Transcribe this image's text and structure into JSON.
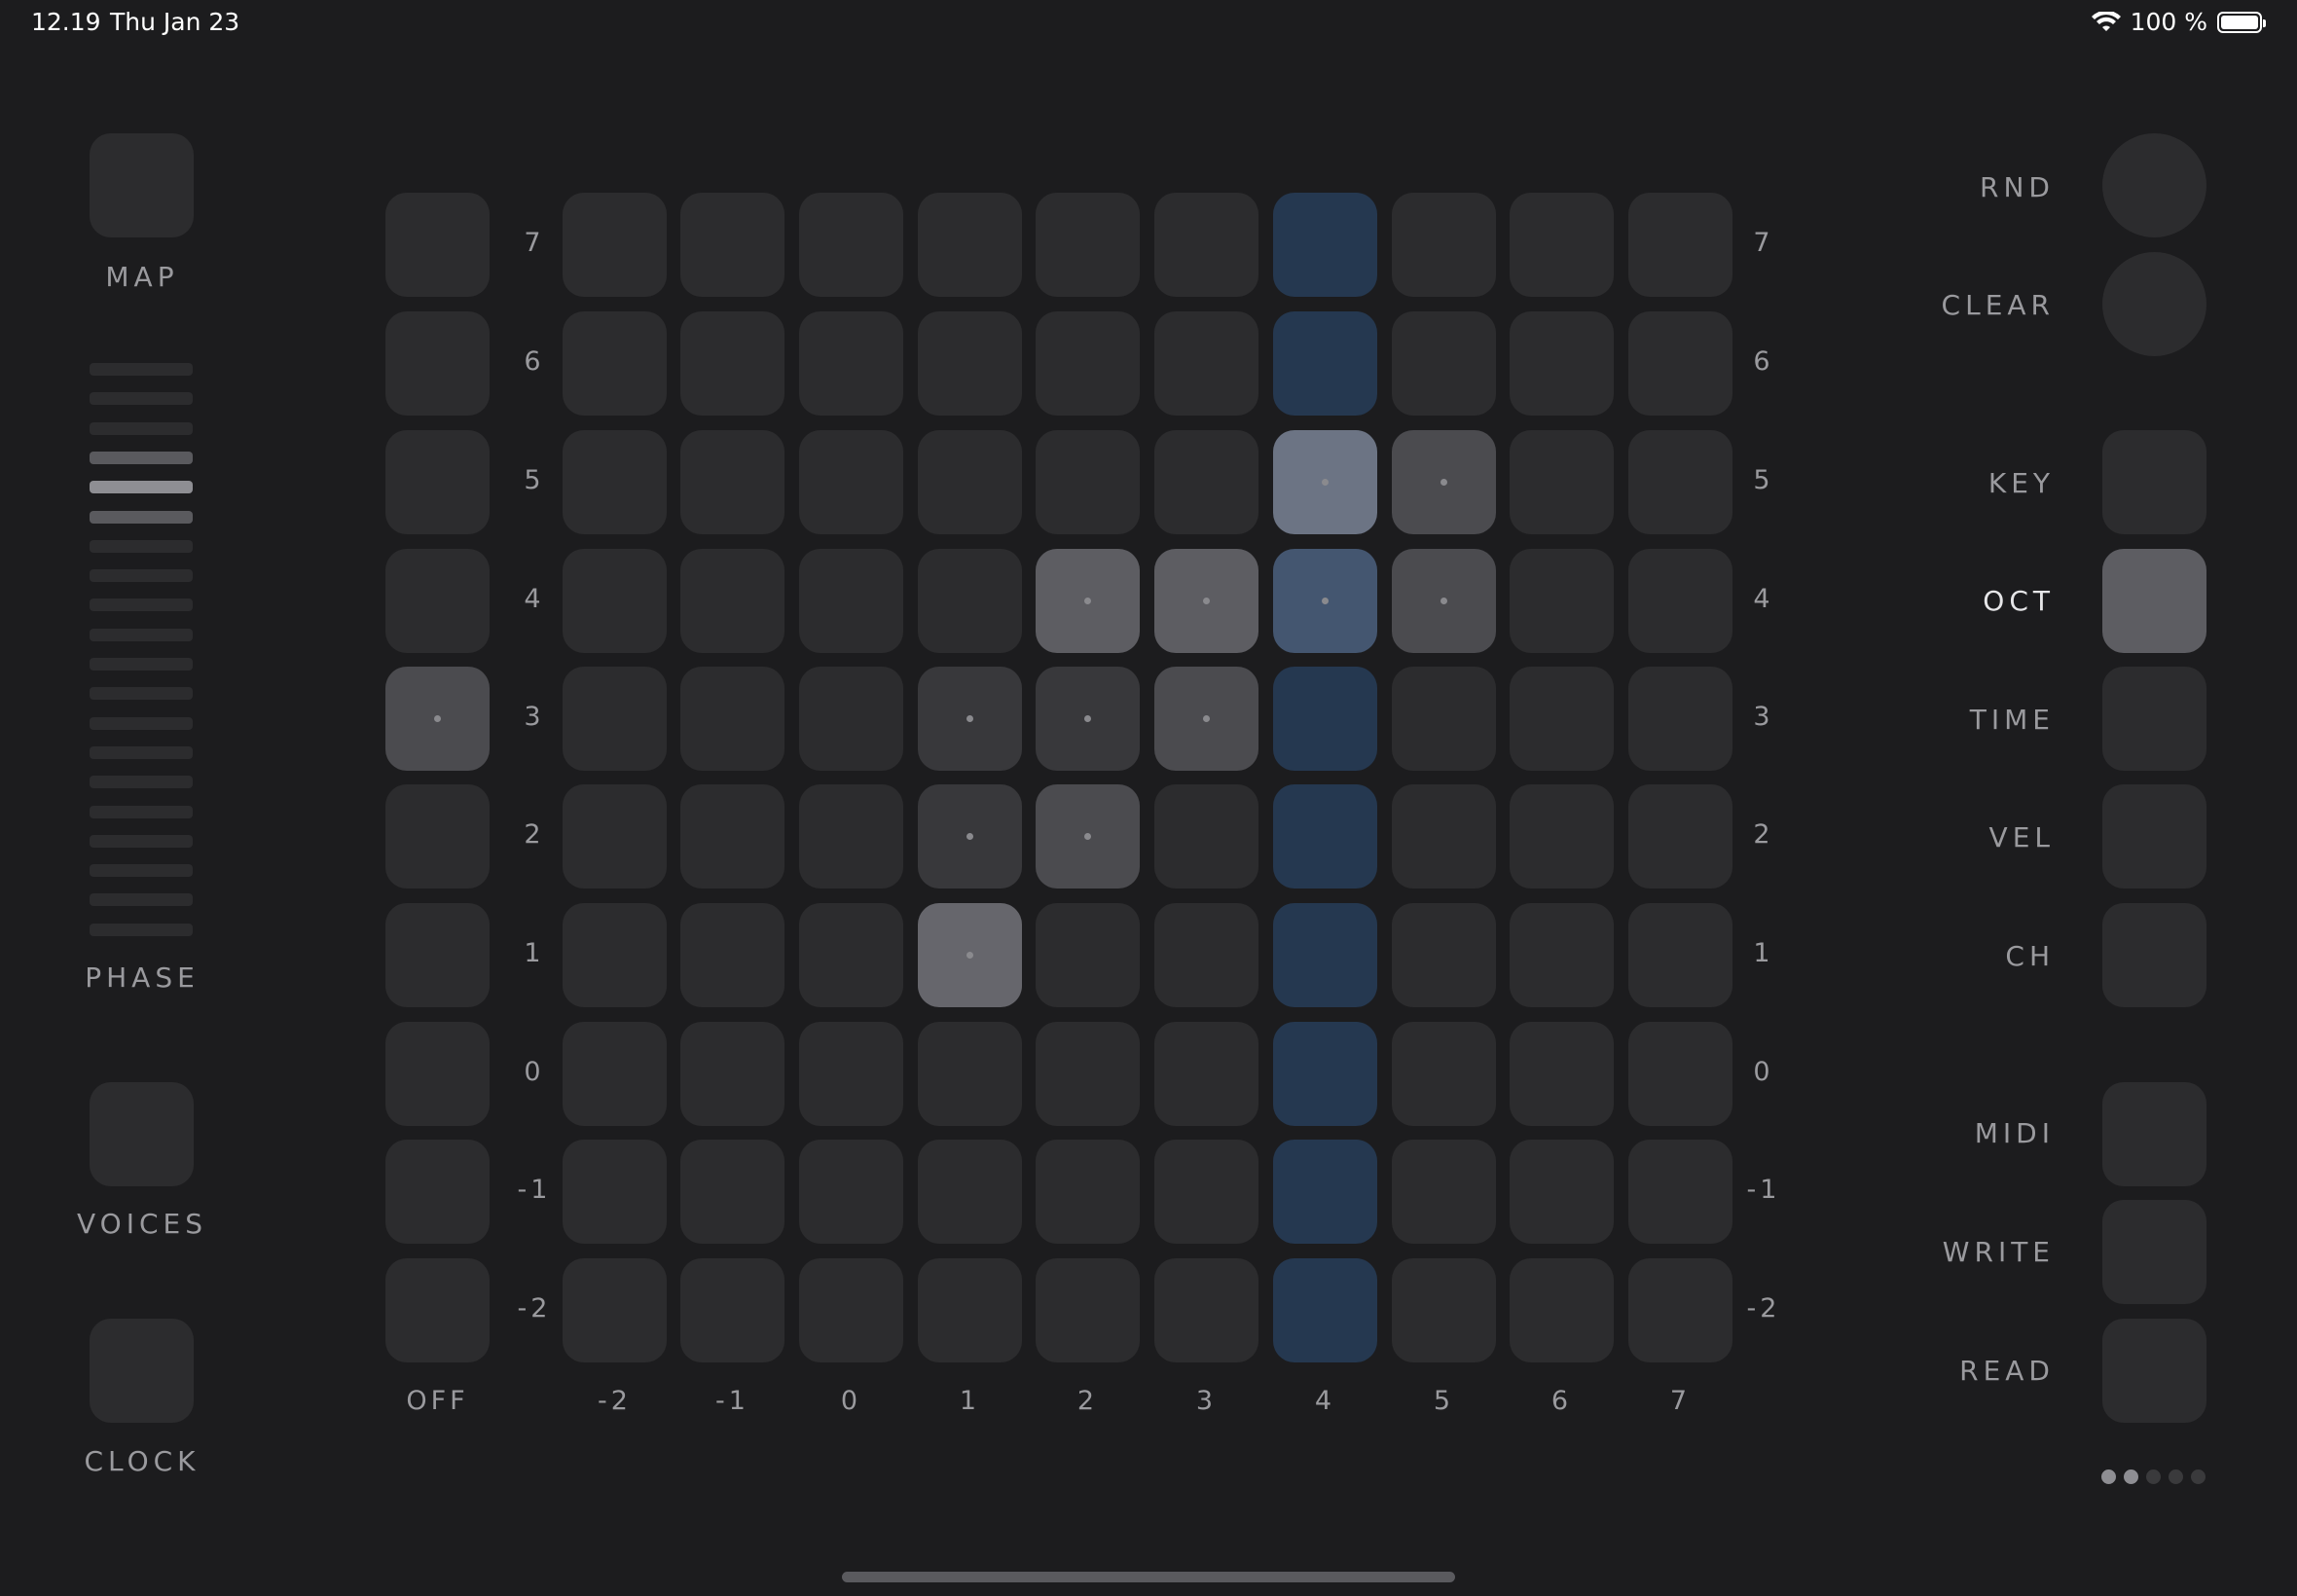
{
  "status_bar": {
    "time": "12.19",
    "date": "Thu Jan 23",
    "battery": "100 %"
  },
  "left_panel": {
    "map_label": "MAP",
    "phase_label": "PHASE",
    "voices_label": "VOICES",
    "clock_label": "CLOCK",
    "phase_levels": [
      "off",
      "off",
      "off",
      "mid",
      "on",
      "mid",
      "off",
      "off",
      "off",
      "off",
      "off",
      "off",
      "off",
      "off",
      "off",
      "off",
      "off",
      "off",
      "off",
      "off"
    ]
  },
  "grid": {
    "row_labels": [
      "7",
      "6",
      "5",
      "4",
      "3",
      "2",
      "1",
      "0",
      "-1",
      "-2"
    ],
    "column_labels": [
      "OFF",
      "-2",
      "-1",
      "0",
      "1",
      "2",
      "3",
      "4",
      "5",
      "6",
      "7"
    ],
    "cells": [
      [
        "",
        "",
        "",
        "",
        "",
        "",
        "",
        "blue",
        "",
        "",
        ""
      ],
      [
        "",
        "",
        "",
        "",
        "",
        "",
        "",
        "blue",
        "",
        "",
        ""
      ],
      [
        "",
        "",
        "",
        "",
        "",
        "",
        "",
        "grey-5 dot",
        "grey-2 dot",
        "",
        ""
      ],
      [
        "",
        "",
        "",
        "",
        "",
        "grey-3 dot",
        "grey-3 dot",
        "blue-light dot",
        "grey-2 dot",
        "",
        ""
      ],
      [
        "grey-2 dot",
        "",
        "",
        "",
        "grey-1 dot",
        "grey-1 dot",
        "grey-2 dot",
        "blue",
        "",
        "",
        ""
      ],
      [
        "",
        "",
        "",
        "",
        "grey-1 dot",
        "grey-2 dot",
        "",
        "blue",
        "",
        "",
        ""
      ],
      [
        "",
        "",
        "",
        "",
        "grey-4 dot",
        "",
        "",
        "blue",
        "",
        "",
        ""
      ],
      [
        "",
        "",
        "",
        "",
        "",
        "",
        "",
        "blue",
        "",
        "",
        ""
      ],
      [
        "",
        "",
        "",
        "",
        "",
        "",
        "",
        "blue",
        "",
        "",
        ""
      ],
      [
        "",
        "",
        "",
        "",
        "",
        "",
        "",
        "blue",
        "",
        "",
        ""
      ]
    ]
  },
  "right_panel": {
    "rnd_label": "RND",
    "clear_label": "CLEAR",
    "key_label": "KEY",
    "oct_label": "OCT",
    "time_label": "TIME",
    "vel_label": "VEL",
    "ch_label": "CH",
    "midi_label": "MIDI",
    "write_label": "WRITE",
    "read_label": "READ",
    "active_mode": "OCT"
  },
  "pager": {
    "pages": 5,
    "active": [
      0,
      1
    ]
  },
  "colors": {
    "background": "#1c1c1e",
    "pad": "#2c2c2e",
    "accent_blue": "#253850",
    "label": "#9a9a9e"
  }
}
